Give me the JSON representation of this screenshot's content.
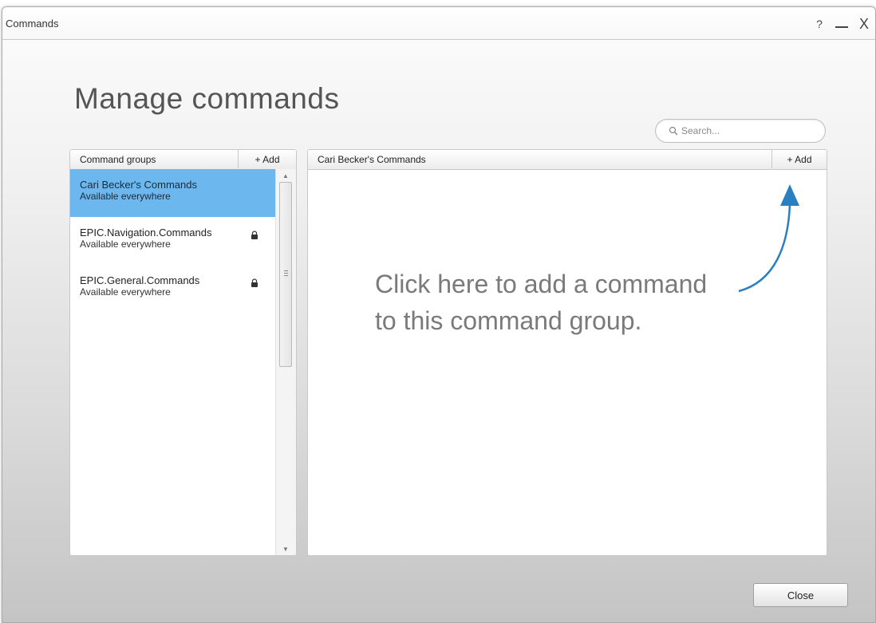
{
  "window": {
    "title": "Commands",
    "help_label": "?",
    "close_label": "X"
  },
  "page_title": "Manage commands",
  "search": {
    "placeholder": "Search..."
  },
  "groups_panel": {
    "header": "Command groups",
    "add_label": "+ Add",
    "items": [
      {
        "name": "Cari Becker's Commands",
        "subtitle": "Available everywhere",
        "selected": true,
        "locked": false
      },
      {
        "name": "EPIC.Navigation.Commands",
        "subtitle": "Available everywhere",
        "selected": false,
        "locked": true
      },
      {
        "name": "EPIC.General.Commands",
        "subtitle": "Available everywhere",
        "selected": false,
        "locked": true
      }
    ]
  },
  "commands_panel": {
    "header": "Cari Becker's Commands",
    "add_label": "+ Add",
    "hint_line1": "Click here to add a command",
    "hint_line2": "to this command group."
  },
  "footer": {
    "close_label": "Close"
  },
  "colors": {
    "selection": "#6bb7ee",
    "arrow": "#2a7fc0"
  },
  "icons": {
    "search": "search-icon",
    "lock": "lock-icon",
    "arrow": "curved-arrow-icon"
  }
}
